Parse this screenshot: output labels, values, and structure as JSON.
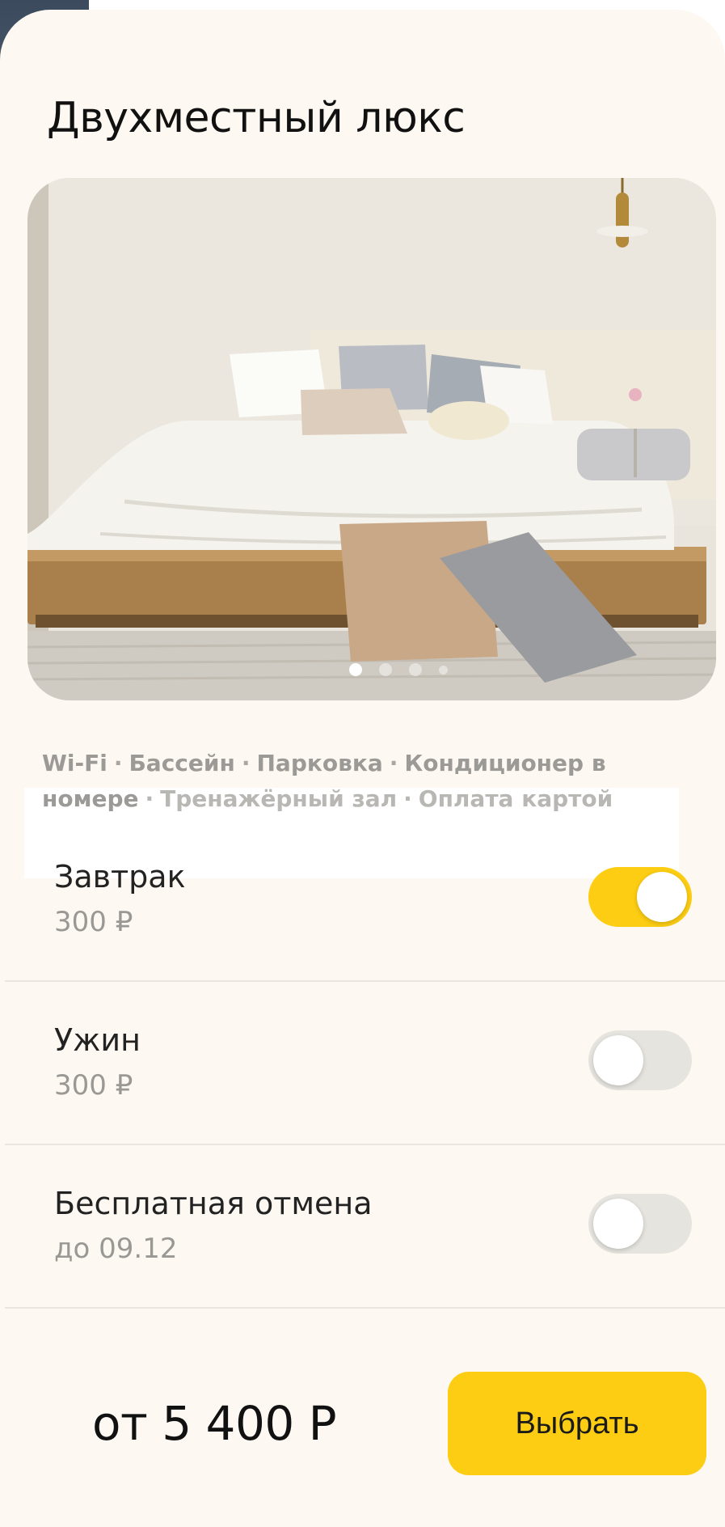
{
  "room": {
    "title": "Двухместный люкс",
    "gallery": {
      "photo_count": 4,
      "active_index": 0
    }
  },
  "amenities": [
    "Wi-Fi",
    "Бассейн",
    "Парковка",
    "Кондиционер в номере",
    "Тренажёрный зал",
    "Оплата картой"
  ],
  "amenity_separator": "·",
  "options": [
    {
      "name": "Завтрак",
      "detail": "300 ₽",
      "enabled": true
    },
    {
      "name": "Ужин",
      "detail": "300 ₽",
      "enabled": false
    },
    {
      "name": "Бесплатная отмена",
      "detail": "до 09.12",
      "enabled": false
    }
  ],
  "footer": {
    "price_label": "от 5 400 Р",
    "select_label": "Выбрать"
  },
  "colors": {
    "accent": "#fccd13",
    "card_background": "#fdf9f2",
    "toggle_off": "#e6e4de",
    "secondary_text": "#9a9895"
  }
}
